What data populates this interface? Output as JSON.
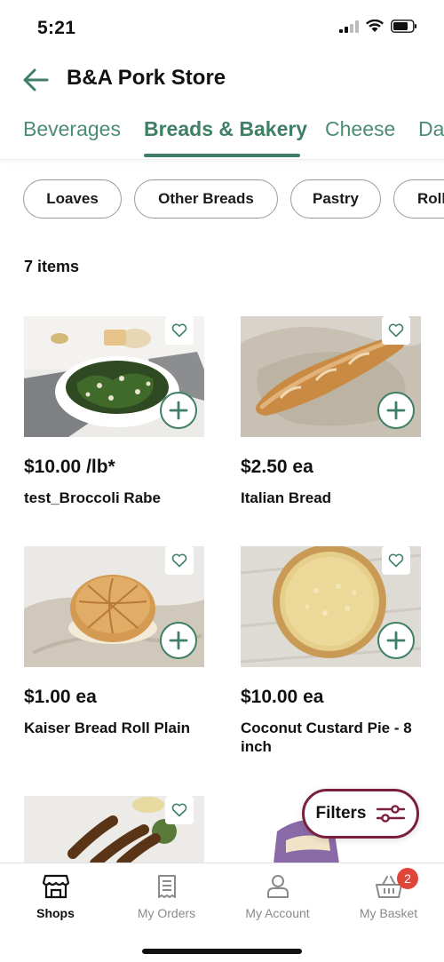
{
  "status_bar": {
    "time": "5:21"
  },
  "header": {
    "store_name": "B&A Pork Store"
  },
  "category_tabs": [
    {
      "label": "Beverages",
      "active": false
    },
    {
      "label": "Breads & Bakery",
      "active": true
    },
    {
      "label": "Cheese",
      "active": false
    },
    {
      "label": "Da",
      "active": false
    }
  ],
  "subcategories": [
    "Loaves",
    "Other Breads",
    "Pastry",
    "Roll"
  ],
  "items_count": "7 items",
  "products": [
    {
      "price": "$10.00  /lb*",
      "name": "test_Broccoli Rabe",
      "image": "broccoli-rabe"
    },
    {
      "price": "$2.50 ea",
      "name": "Italian Bread",
      "image": "italian-bread"
    },
    {
      "price": "$1.00 ea",
      "name": "Kaiser Bread Roll Plain",
      "image": "kaiser-roll"
    },
    {
      "price": "$10.00 ea",
      "name": "Coconut Custard Pie - 8 inch",
      "image": "coconut-pie"
    }
  ],
  "filters": {
    "label": "Filters"
  },
  "bottom_nav": [
    {
      "label": "Shops",
      "icon": "storefront-icon",
      "active": true
    },
    {
      "label": "My Orders",
      "icon": "receipt-icon",
      "active": false
    },
    {
      "label": "My Account",
      "icon": "person-icon",
      "active": false
    },
    {
      "label": "My Basket",
      "icon": "basket-icon",
      "active": false,
      "badge": "2"
    }
  ],
  "colors": {
    "brand_green": "#3f7f66",
    "filter_border": "#7a1f3d",
    "badge_red": "#e0453a"
  }
}
